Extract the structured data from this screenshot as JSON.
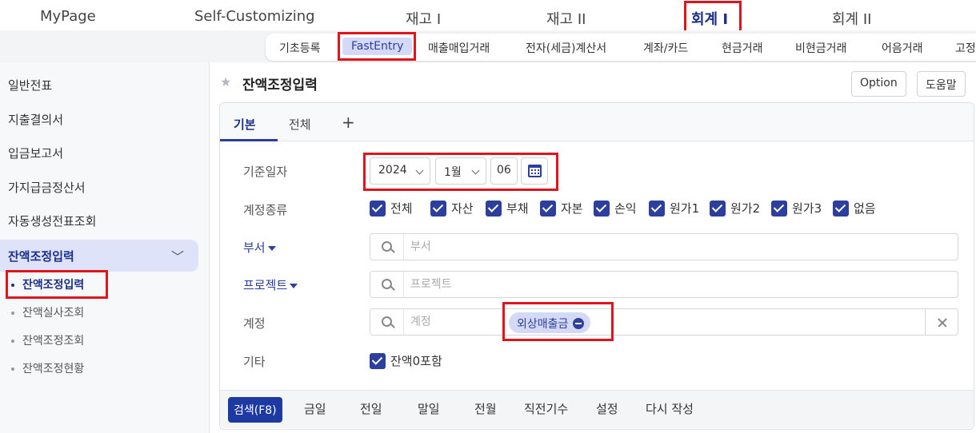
{
  "topnav": {
    "items": [
      "MyPage",
      "Self-Customizing",
      "재고 I",
      "재고 II",
      "회계 I",
      "회계 II"
    ],
    "active": "회계 I"
  },
  "subnav": {
    "items": [
      "기초등록",
      "FastEntry",
      "매출매입거래",
      "전자(세금)계산서",
      "계좌/카드",
      "현금거래",
      "비현금거래",
      "어음거래",
      "고정"
    ],
    "active": "FastEntry"
  },
  "sidebar": {
    "items": [
      "일반전표",
      "지출결의서",
      "입금보고서",
      "가지급금정산서",
      "자동생성전표조회"
    ],
    "group": {
      "label": "잔액조정입력",
      "children": [
        "잔액조정입력",
        "잔액실사조회",
        "잔액조정조회",
        "잔액조정현황"
      ],
      "active_child": "잔액조정입력"
    }
  },
  "page": {
    "title": "잔액조정입력",
    "option_label": "Option",
    "help_label": "도움말"
  },
  "tabs": [
    "기본",
    "전체"
  ],
  "form": {
    "date_label": "기준일자",
    "year": "2024",
    "month": "1월",
    "day": "06",
    "account_type_label": "계정종류",
    "account_types": [
      "전체",
      "자산",
      "부채",
      "자본",
      "손익",
      "원가1",
      "원가2",
      "원가3",
      "없음"
    ],
    "department_label": "부서",
    "department_placeholder": "부서",
    "project_label": "프로젝트",
    "project_placeholder": "프로젝트",
    "account_label": "계정",
    "account_placeholder": "계정",
    "account_chip": "외상매출금",
    "other_label": "기타",
    "other_option": "잔액0포함"
  },
  "actions": [
    "검색(F8)",
    "금일",
    "전일",
    "말일",
    "전월",
    "직전기수",
    "설정",
    "다시 작성"
  ],
  "colors": {
    "brand": "#1b2f8a",
    "accent": "#2c3e9e",
    "highlight": "#e0141c",
    "chip_bg": "#d4d9f6"
  }
}
